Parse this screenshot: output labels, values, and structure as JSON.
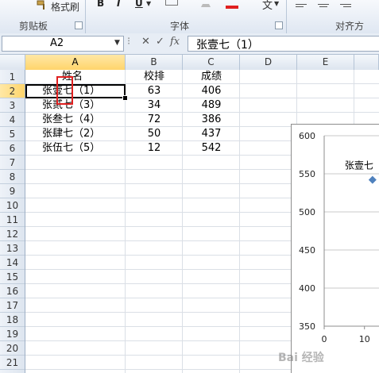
{
  "ribbon": {
    "format_painter_label": "格式刷",
    "bold": "B",
    "italic": "I",
    "underline": "U",
    "clipboard_group": "剪贴板",
    "font_group": "字体",
    "align_group": "对齐方",
    "wen": "文"
  },
  "formula_bar": {
    "name_box": "A2",
    "cancel": "✕",
    "enter": "✓",
    "fx": "fx",
    "content": "张壹七（1）"
  },
  "columns": [
    "A",
    "B",
    "C",
    "D",
    "E"
  ],
  "rows": [
    "1",
    "2",
    "3",
    "4",
    "5",
    "6",
    "7",
    "8",
    "9",
    "10",
    "11",
    "12",
    "13",
    "14",
    "15",
    "16",
    "17",
    "18",
    "19",
    "20",
    "21"
  ],
  "table": {
    "headers": [
      "姓名",
      "校排",
      "成绩"
    ],
    "rows": [
      {
        "name": "张壹七（1）",
        "rank": "63",
        "score": "406"
      },
      {
        "name": "张贰七（3）",
        "rank": "34",
        "score": "489"
      },
      {
        "name": "张叁七（4）",
        "rank": "72",
        "score": "386"
      },
      {
        "name": "张肆七（2）",
        "rank": "50",
        "score": "437"
      },
      {
        "name": "张伍七（5）",
        "rank": "12",
        "score": "542"
      }
    ]
  },
  "chart_data": {
    "type": "scatter",
    "yticks": [
      "600",
      "550",
      "500",
      "450",
      "400",
      "350"
    ],
    "xticks": [
      "0",
      "10"
    ],
    "ylim": [
      350,
      600
    ],
    "xlim": [
      0,
      14
    ],
    "points": [
      {
        "x": 12,
        "y": 542
      }
    ],
    "point_label": "张壹七",
    "marker_color": "#4f81bd"
  },
  "watermark": "Bai 经验"
}
